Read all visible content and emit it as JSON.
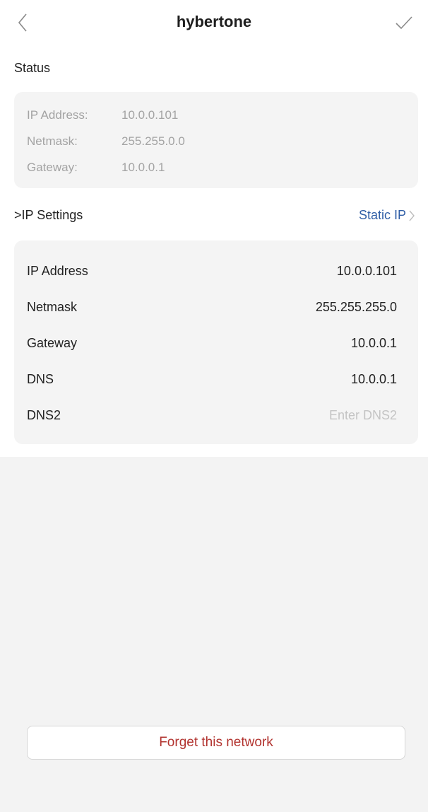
{
  "header": {
    "title": "hybertone",
    "back_icon": "chevron-left-icon",
    "confirm_icon": "checkmark-icon"
  },
  "status": {
    "label": "Status",
    "rows": [
      {
        "key": "IP Address:",
        "value": "10.0.0.101"
      },
      {
        "key": "Netmask:",
        "value": "255.255.0.0"
      },
      {
        "key": "Gateway:",
        "value": "10.0.0.1"
      }
    ]
  },
  "ip_settings": {
    "label": ">IP Settings",
    "mode": "Static IP",
    "fields": [
      {
        "key": "IP Address",
        "value": "10.0.0.101",
        "placeholder": ""
      },
      {
        "key": "Netmask",
        "value": "255.255.255.0",
        "placeholder": ""
      },
      {
        "key": "Gateway",
        "value": "10.0.0.1",
        "placeholder": ""
      },
      {
        "key": "DNS",
        "value": "10.0.0.1",
        "placeholder": ""
      },
      {
        "key": "DNS2",
        "value": "",
        "placeholder": "Enter DNS2"
      }
    ]
  },
  "forget_button": {
    "label": "Forget this network"
  },
  "colors": {
    "accent_link": "#2f5ea6",
    "danger": "#b2332f",
    "card_bg": "#f4f4f4",
    "muted_text": "#a3a3a3"
  }
}
